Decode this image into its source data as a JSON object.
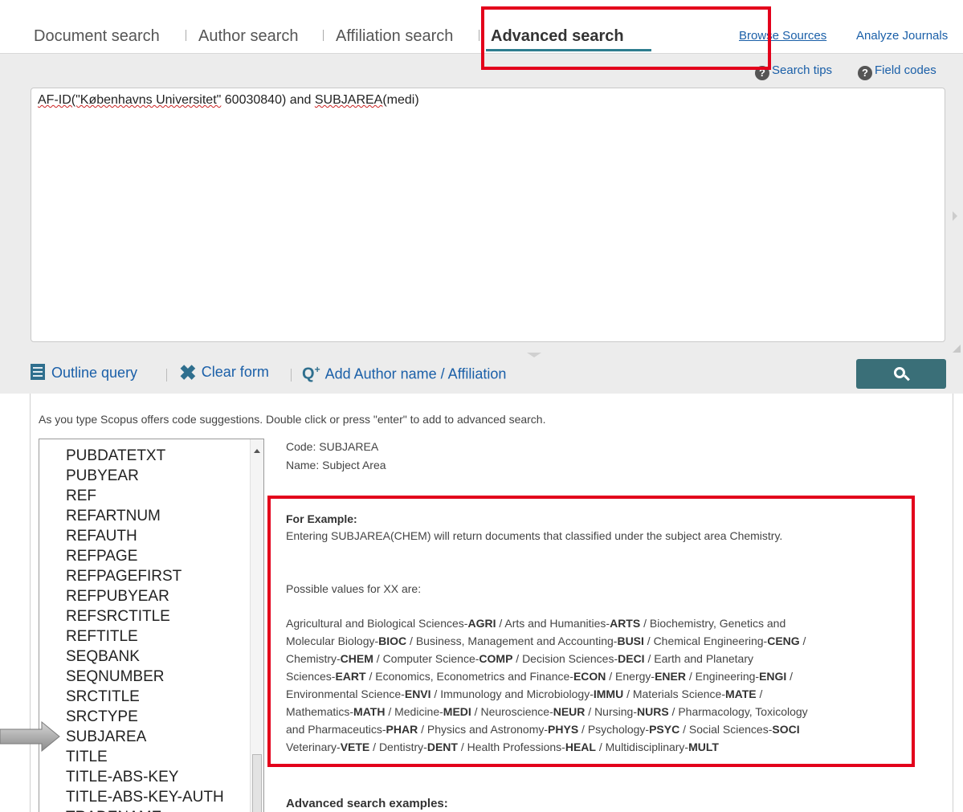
{
  "tabs": {
    "document": "Document search",
    "author": "Author search",
    "affiliation": "Affiliation search",
    "advanced": "Advanced search",
    "browse_sources": "Browse Sources",
    "analyze_journals": "Analyze Journals"
  },
  "help": {
    "search_tips": "Search tips",
    "field_codes": "Field codes",
    "help_icon_char": "?"
  },
  "query": {
    "part1": "AF-ID(\"Københavns Universitet\"",
    "part2": " 60030840)  and ",
    "part3": "SUBJAREA",
    "part4": "(medi)"
  },
  "toolbar": {
    "outline_query": "Outline query",
    "clear_form": "Clear form",
    "add_author": "Add Author name / Affiliation",
    "clear_icon": "✖",
    "add_icon": "Q",
    "add_icon_sup": "+"
  },
  "hint": "As you type Scopus offers code suggestions. Double click or press \"enter\" to add to advanced search.",
  "code_list": {
    "items": [
      "PUBDATETXT",
      "PUBYEAR",
      "REF",
      "REFARTNUM",
      "REFAUTH",
      "REFPAGE",
      "REFPAGEFIRST",
      "REFPUBYEAR",
      "REFSRCTITLE",
      "REFTITLE",
      "SEQBANK",
      "SEQNUMBER",
      "SRCTITLE",
      "SRCTYPE",
      "SUBJAREA",
      "TITLE",
      "TITLE-ABS-KEY",
      "TITLE-ABS-KEY-AUTH",
      "TRADENAME"
    ]
  },
  "detail": {
    "code_label": "Code:",
    "code_value": "SUBJAREA",
    "name_label": "Name:",
    "name_value": "Subject Area",
    "example_label": "For Example:",
    "example_text": "Entering SUBJAREA(CHEM) will return documents that classified under the subject area Chemistry.",
    "possible_values": "Possible values for XX are:",
    "lines": [
      [
        [
          "Agricultural and Biological Sciences-",
          "AGRI"
        ],
        [
          " / Arts and Humanities-",
          "ARTS"
        ],
        [
          " / Biochemistry, Genetics and",
          ""
        ]
      ],
      [
        [
          "Molecular Biology-",
          "BIOC"
        ],
        [
          " / Business, Management and Accounting-",
          "BUSI"
        ],
        [
          " / Chemical Engineering-",
          "CENG"
        ],
        [
          " /",
          ""
        ]
      ],
      [
        [
          "Chemistry-",
          "CHEM"
        ],
        [
          " / Computer Science-",
          "COMP"
        ],
        [
          " / Decision Sciences-",
          "DECI"
        ],
        [
          " / Earth and Planetary",
          ""
        ]
      ],
      [
        [
          "Sciences-",
          "EART"
        ],
        [
          " / Economics, Econometrics and Finance-",
          "ECON"
        ],
        [
          " / Energy-",
          "ENER"
        ],
        [
          " / Engineering-",
          "ENGI"
        ],
        [
          " /",
          ""
        ]
      ],
      [
        [
          "Environmental Science-",
          "ENVI"
        ],
        [
          " / Immunology and Microbiology-",
          "IMMU"
        ],
        [
          " / Materials Science-",
          "MATE"
        ],
        [
          " /",
          ""
        ]
      ],
      [
        [
          "Mathematics-",
          "MATH"
        ],
        [
          " / Medicine-",
          "MEDI"
        ],
        [
          " / Neuroscience-",
          "NEUR"
        ],
        [
          " / Nursing-",
          "NURS"
        ],
        [
          " / Pharmacology, Toxicology",
          ""
        ]
      ],
      [
        [
          "and Pharmaceutics-",
          "PHAR"
        ],
        [
          " / Physics and Astronomy-",
          "PHYS"
        ],
        [
          " / Psychology-",
          "PSYC"
        ],
        [
          " / Social Sciences-",
          "SOCI"
        ]
      ],
      [
        [
          "Veterinary-",
          "VETE"
        ],
        [
          " / Dentistry-",
          "DENT"
        ],
        [
          " / Health Professions-",
          "HEAL"
        ],
        [
          " / Multidisciplinary-",
          "MULT"
        ]
      ]
    ],
    "advanced_examples": "Advanced search examples:"
  },
  "colors": {
    "highlight": "#e3001b",
    "link": "#1a5fa8",
    "search_button": "#3a6f78",
    "tab_underline": "#2e7d8f"
  }
}
